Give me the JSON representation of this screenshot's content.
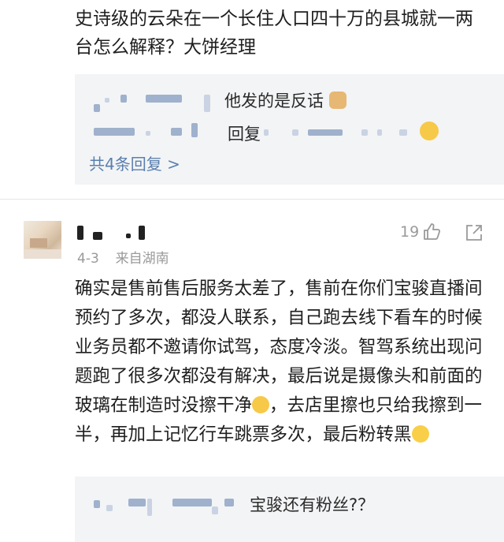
{
  "post": {
    "text": "史诗级的云朵在一个长住人口四十万的县城就一两台怎么解释？大饼经理"
  },
  "post_replies": {
    "items": [
      {
        "text": "他发的是反话"
      },
      {
        "text": "回复"
      }
    ],
    "more_label": "共4条回复 >"
  },
  "comment": {
    "date": "4-3",
    "location": "来自湖南",
    "like_count": "19",
    "body": "确实是售前售后服务太差了，售前在你们宝骏直播间预约了多次，都没人联系，自己跑去线下看车的时候业务员都不邀请你试驾，态度冷淡。智驾系统出现问题跑了很多次都没有解决，最后说是摄像头和前面的玻璃在制造时没擦干净",
    "body_2": "，去店里擦也只给我擦到一半，再加上记忆行车跳票多次，最后粉转黑"
  },
  "comment_replies": {
    "items": [
      {
        "text": "宝骏还有粉丝?？"
      }
    ]
  },
  "icons": {
    "like": "thumbs-up-icon",
    "share": "share-icon"
  },
  "colors": {
    "link": "#5a7fae",
    "reply_bg": "#f3f4f6",
    "meta": "#9a9a9a"
  }
}
